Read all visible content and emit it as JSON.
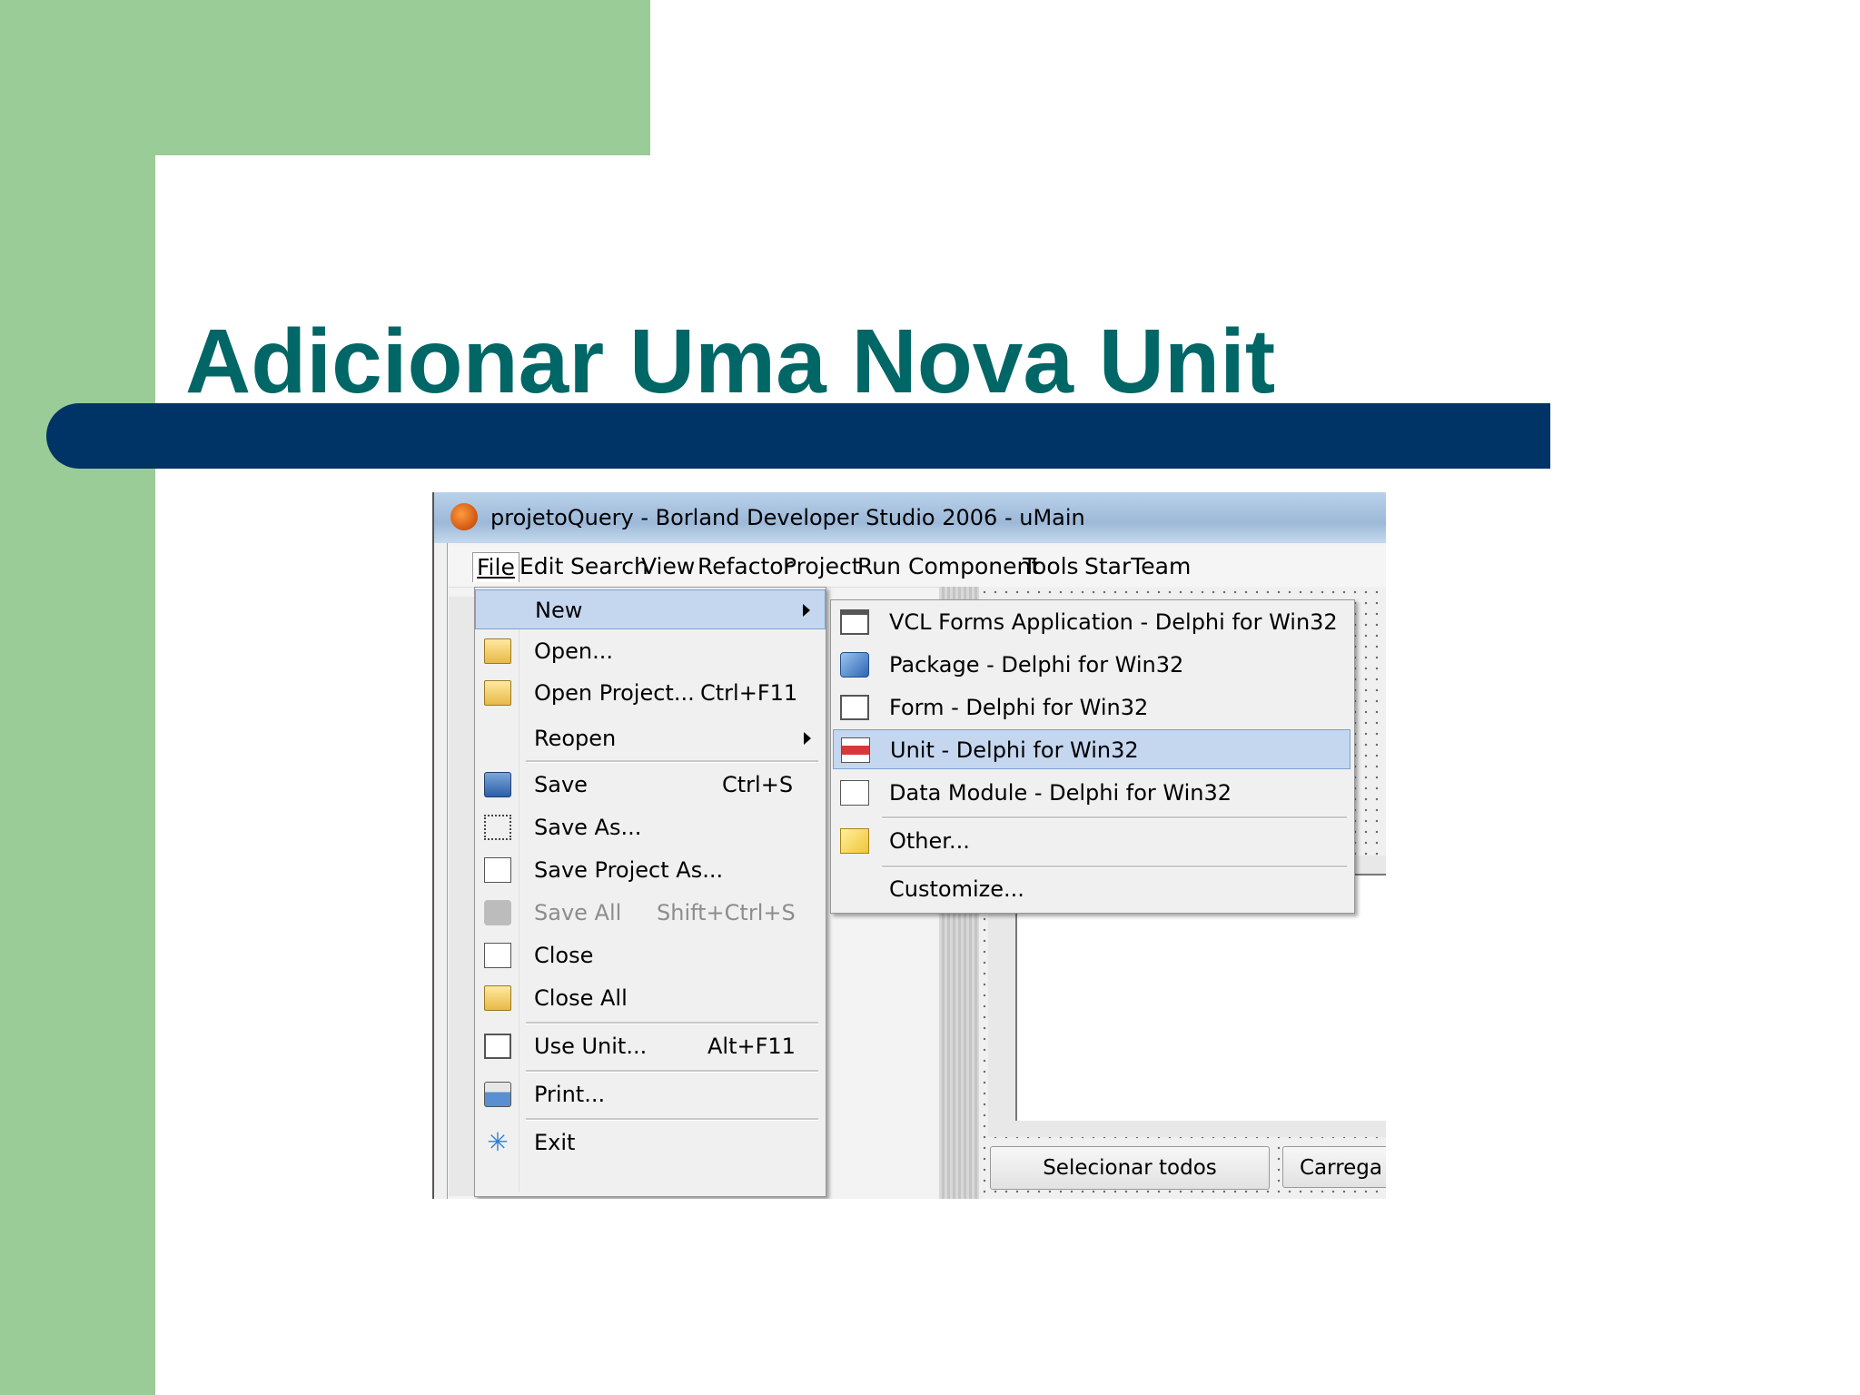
{
  "slide": {
    "title": "Adicionar Uma Nova Unit"
  },
  "window": {
    "title": "projetoQuery - Borland Developer Studio 2006 - uMain",
    "icon": "spartan-helmet-icon"
  },
  "menubar": {
    "items": [
      "File",
      "Edit",
      "Search",
      "View",
      "Refactor",
      "Project",
      "Run",
      "Component",
      "Tools",
      "StarTeam"
    ]
  },
  "file_menu": {
    "items": [
      {
        "label": "New",
        "shortcut": "",
        "icon": "",
        "highlighted": true,
        "submenu": true
      },
      {
        "label": "Open...",
        "shortcut": "",
        "icon": "open-folder-icon"
      },
      {
        "label": "Open Project...",
        "shortcut": "Ctrl+F11",
        "icon": "open-project-icon"
      },
      {
        "label": "Reopen",
        "shortcut": "",
        "submenu": true
      },
      {
        "label": "Save",
        "shortcut": "Ctrl+S",
        "icon": "save-disk-icon"
      },
      {
        "label": "Save As...",
        "shortcut": "",
        "icon": "save-as-icon"
      },
      {
        "label": "Save Project As...",
        "shortcut": "",
        "icon": "save-project-icon"
      },
      {
        "label": "Save All",
        "shortcut": "Shift+Ctrl+S",
        "icon": "save-all-icon",
        "disabled": true
      },
      {
        "label": "Close",
        "shortcut": "",
        "icon": "close-file-icon"
      },
      {
        "label": "Close All",
        "shortcut": "",
        "icon": "close-all-icon"
      },
      {
        "label": "Use Unit...",
        "shortcut": "Alt+F11",
        "icon": "use-unit-icon"
      },
      {
        "label": "Print...",
        "shortcut": "",
        "icon": "printer-icon"
      },
      {
        "label": "Exit",
        "shortcut": "",
        "icon": "exit-icon"
      }
    ]
  },
  "new_submenu": {
    "items": [
      {
        "label": "VCL Forms Application - Delphi for Win32",
        "icon": "vcl-forms-icon"
      },
      {
        "label": "Package - Delphi for Win32",
        "icon": "package-icon"
      },
      {
        "label": "Form - Delphi for Win32",
        "icon": "form-icon"
      },
      {
        "label": "Unit - Delphi for Win32",
        "icon": "unit-icon",
        "highlighted": true
      },
      {
        "label": "Data Module - Delphi for Win32",
        "icon": "data-module-icon"
      },
      {
        "label": "Other...",
        "icon": "other-icon"
      },
      {
        "label": "Customize...",
        "icon": ""
      }
    ]
  },
  "form_designer": {
    "button_select_all": "Selecionar todos",
    "button_load": "Carrega"
  },
  "colors": {
    "slide_green": "#99cc96",
    "title_bar_navy": "#003366",
    "title_teal": "#006666",
    "menu_highlight": "#c5d6ef"
  }
}
